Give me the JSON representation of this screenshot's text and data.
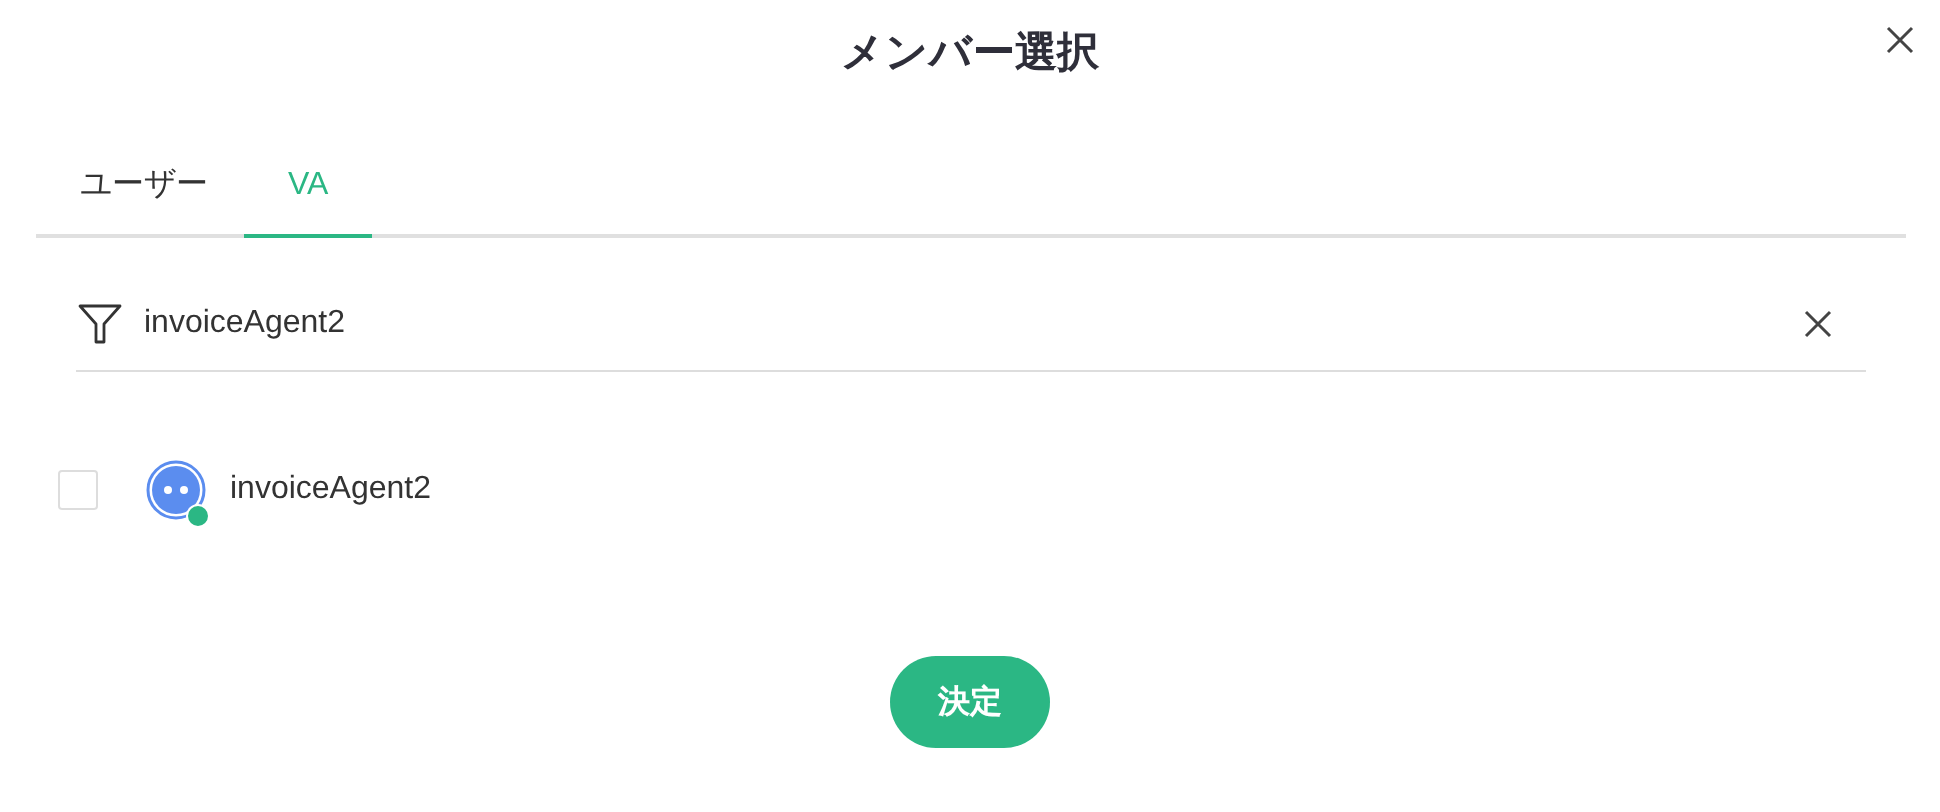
{
  "dialog": {
    "title": "メンバー選択"
  },
  "tabs": [
    {
      "label": "ユーザー",
      "selected": false
    },
    {
      "label": "VA",
      "selected": true
    }
  ],
  "search": {
    "value": "invoiceAgent2"
  },
  "members": [
    {
      "name": "invoiceAgent2",
      "checked": false,
      "online": true
    }
  ],
  "confirm_button": "決定"
}
